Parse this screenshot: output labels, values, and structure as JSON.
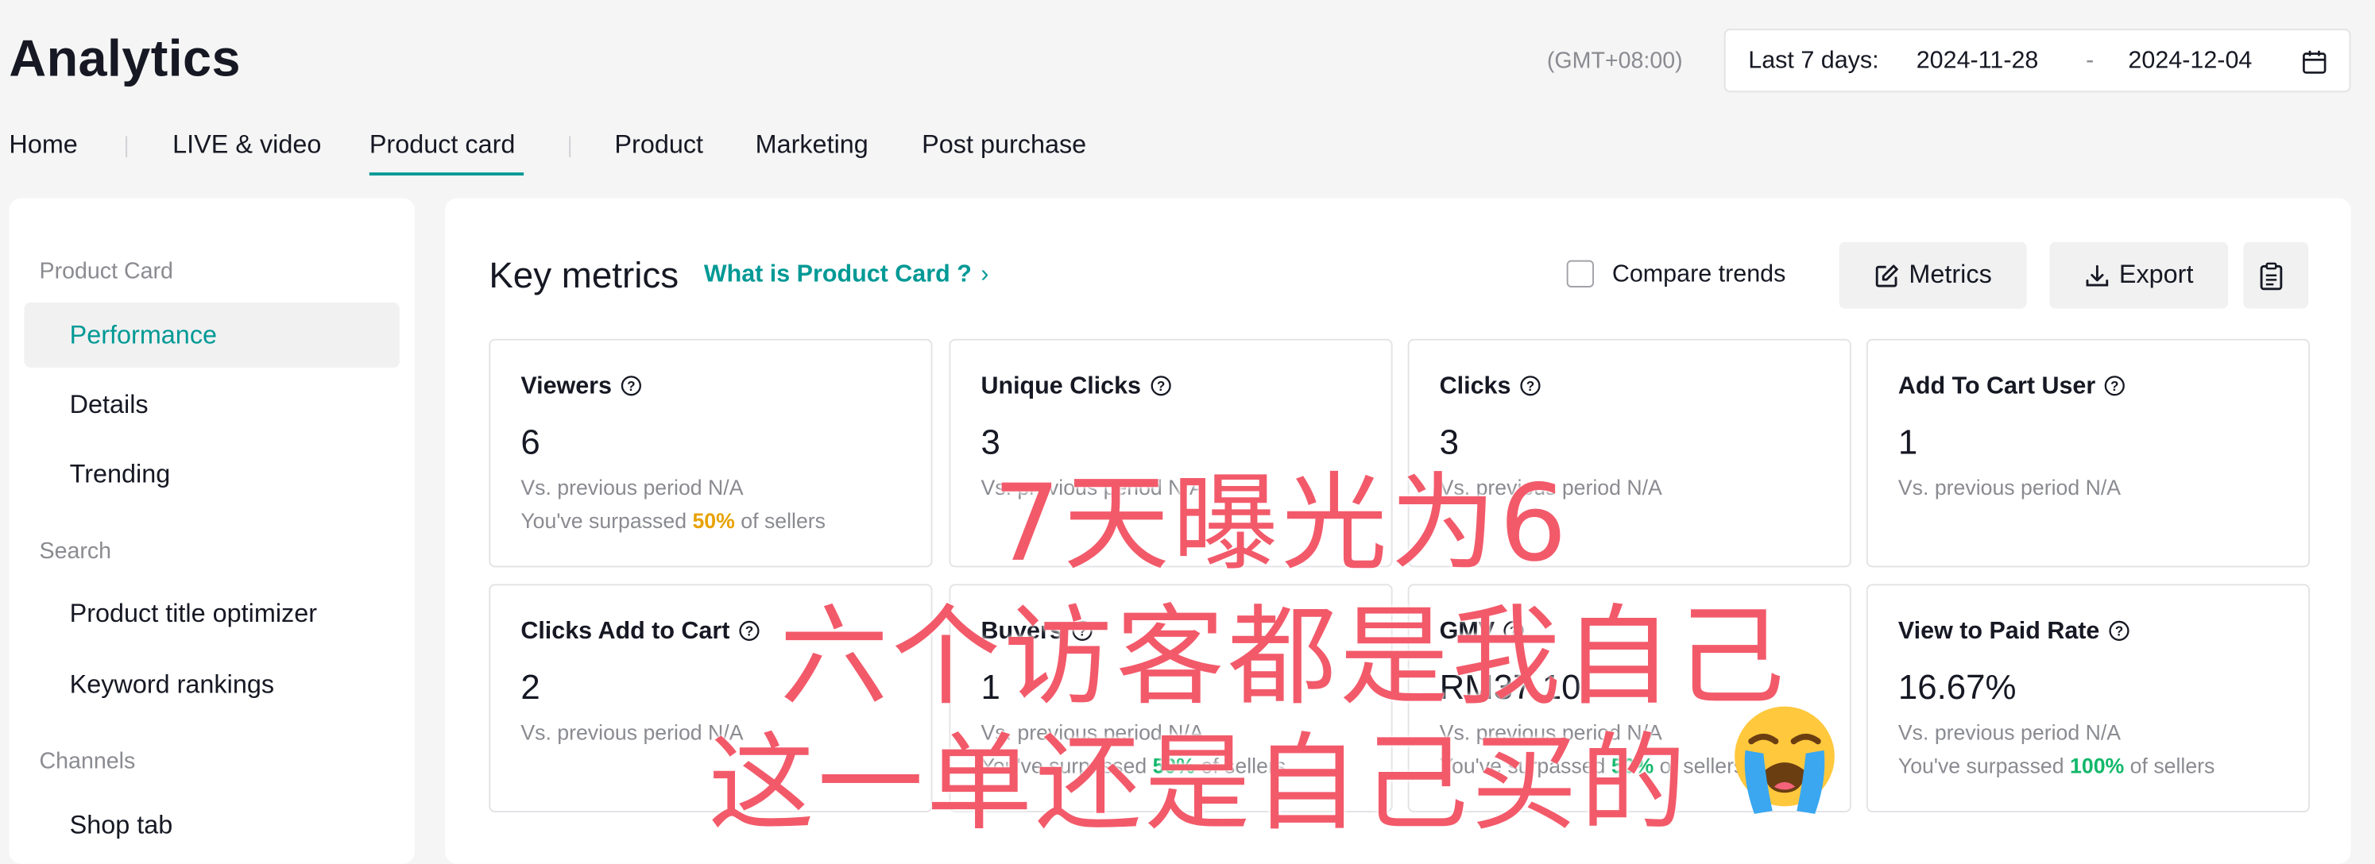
{
  "header": {
    "title": "Analytics",
    "timezone": "(GMT+08:00)",
    "date_label": "Last 7 days:",
    "date_start": "2024-11-28",
    "date_sep": "-",
    "date_end": "2024-12-04",
    "calendar_icon": "calendar-icon"
  },
  "tabs": [
    {
      "label": "Home"
    },
    {
      "label": "LIVE & video"
    },
    {
      "label": "Product card",
      "active": true
    },
    {
      "label": "Product"
    },
    {
      "label": "Marketing"
    },
    {
      "label": "Post purchase"
    }
  ],
  "sidebar": {
    "groups": [
      {
        "label": "Product Card",
        "items": [
          {
            "label": "Performance",
            "active": true
          },
          {
            "label": "Details"
          },
          {
            "label": "Trending"
          }
        ]
      },
      {
        "label": "Search",
        "items": [
          {
            "label": "Product title optimizer"
          },
          {
            "label": "Keyword rankings"
          }
        ]
      },
      {
        "label": "Channels",
        "items": [
          {
            "label": "Shop tab"
          }
        ]
      }
    ]
  },
  "main": {
    "title": "Key metrics",
    "help_link": "What is Product Card ?",
    "compare_label": "Compare trends",
    "metrics_button": "Metrics",
    "export_button": "Export",
    "accent_color": "#009995",
    "cards": [
      {
        "title": "Viewers",
        "value": "6",
        "vs": "Vs. previous period N/A",
        "surpass_pre": "You've surpassed ",
        "surpass_pct": "50%",
        "surpass_post": " of sellers",
        "pct_color": "orange"
      },
      {
        "title": "Unique Clicks",
        "value": "3",
        "vs": "Vs. previous period N/A"
      },
      {
        "title": "Clicks",
        "value": "3",
        "vs": "Vs. previous period N/A"
      },
      {
        "title": "Add To Cart User",
        "value": "1",
        "vs": "Vs. previous period N/A"
      },
      {
        "title": "Clicks Add to Cart",
        "value": "2",
        "vs": "Vs. previous period N/A"
      },
      {
        "title": "Buyers",
        "value": "1",
        "vs": "Vs. previous period N/A",
        "surpass_pre": "You've surpassed ",
        "surpass_pct": "50%",
        "surpass_post": " of sellers",
        "pct_color": "green"
      },
      {
        "title": "GMV",
        "value": "RM37.10",
        "vs": "Vs. previous period N/A",
        "surpass_pre": "You've surpassed ",
        "surpass_pct": "50%",
        "surpass_post": " of sellers",
        "pct_color": "green"
      },
      {
        "title": "View to Paid Rate",
        "value": "16.67%",
        "vs": "Vs. previous period N/A",
        "surpass_pre": "You've surpassed ",
        "surpass_pct": "100%",
        "surpass_post": " of sellers",
        "pct_color": "green"
      }
    ]
  },
  "overlay": {
    "line1": "7天曝光为6",
    "line2": "六个访客都是我自己",
    "line3": "这一单还是自己买的",
    "emoji": "crying-face-icon",
    "color": "#f25a6a"
  }
}
